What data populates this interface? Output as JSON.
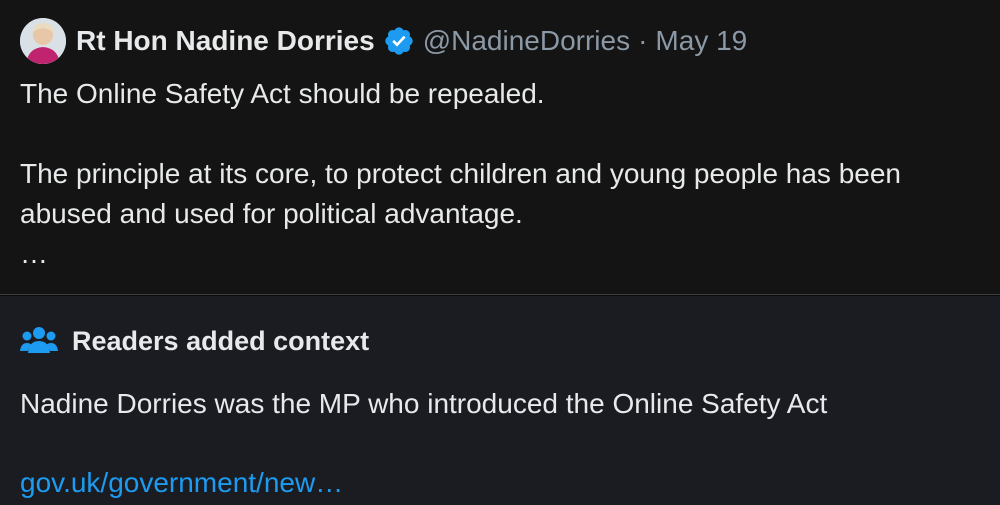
{
  "tweet": {
    "display_name": "Rt Hon Nadine Dorries",
    "handle": "@NadineDorries",
    "separator": "·",
    "date": "May 19",
    "avatar_icon": "profile-photo",
    "verified_icon": "verified-badge-icon",
    "text_lines": [
      "The Online Safety Act should be repealed.",
      "",
      "The principle at its core, to protect children and young people has been abused and used for political advantage.",
      "…"
    ]
  },
  "community_note": {
    "icon": "people-icon",
    "title": "Readers added context",
    "body": "Nadine Dorries was the MP who introduced the Online Safety Act",
    "link_text": "gov.uk/government/new…"
  },
  "colors": {
    "tweet_background": "#141414",
    "note_background": "#1b1c21",
    "text_primary": "#e7e9ea",
    "text_secondary": "#8b98a5",
    "link": "#1d9bf0",
    "verified_badge": "#1d9bf0"
  }
}
